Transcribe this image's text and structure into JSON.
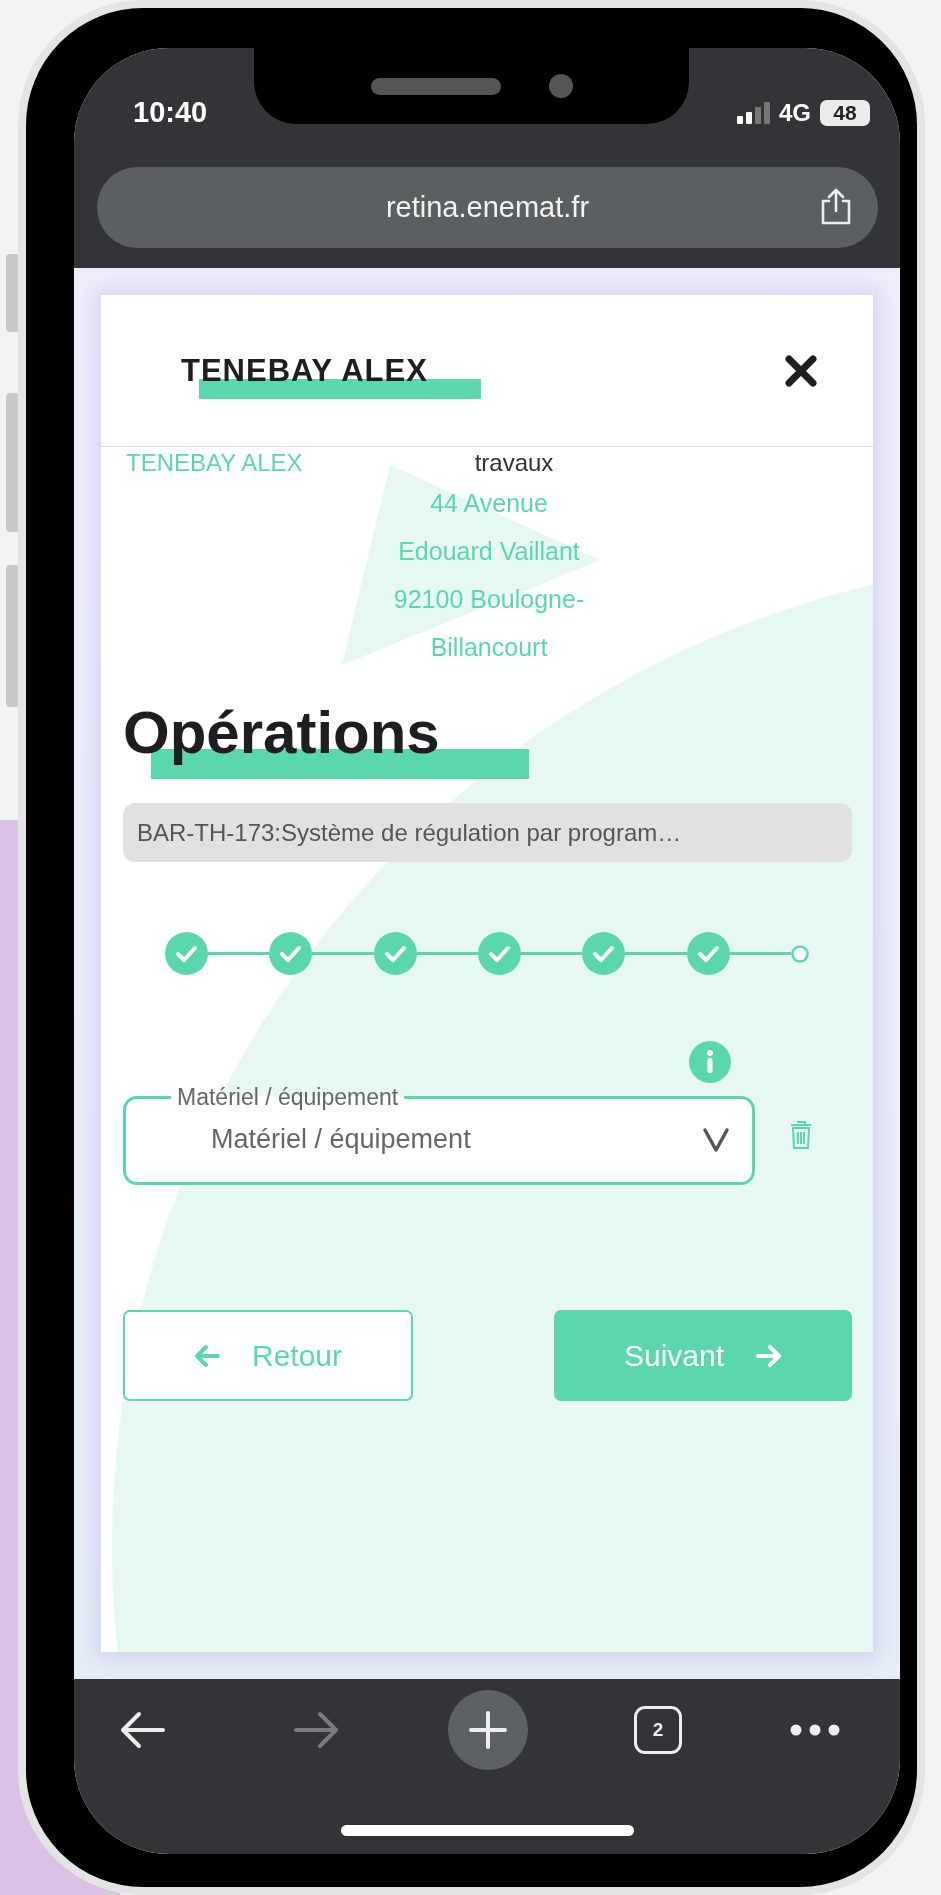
{
  "status_bar": {
    "time": "10:40",
    "network": "4G",
    "battery": "48"
  },
  "browser": {
    "url": "retina.enemat.fr",
    "tab_count": "2",
    "nav": [
      {
        "kind": "back",
        "disabled": false
      },
      {
        "kind": "forward",
        "disabled": true
      }
    ]
  },
  "modal": {
    "title": "TENEBAY ALEX",
    "client_name": "TENEBAY ALEX",
    "site_label": "travaux",
    "address": "44 Avenue\nEdouard Vaillant\n92100 Boulogne-\nBillancourt",
    "section_title": "Opérations",
    "operation": "BAR-TH-173:Système de régulation par program…",
    "steps": [
      {
        "completed": true
      },
      {
        "completed": true
      },
      {
        "completed": true
      },
      {
        "completed": true
      },
      {
        "completed": true
      },
      {
        "completed": true
      },
      {
        "completed": false
      }
    ],
    "field": {
      "label": "Matériel / équipement",
      "placeholder": "Matériel / équipement"
    },
    "buttons": [
      {
        "label": "Retour",
        "kind": "back"
      },
      {
        "label": "Suivant",
        "kind": "next"
      }
    ]
  }
}
